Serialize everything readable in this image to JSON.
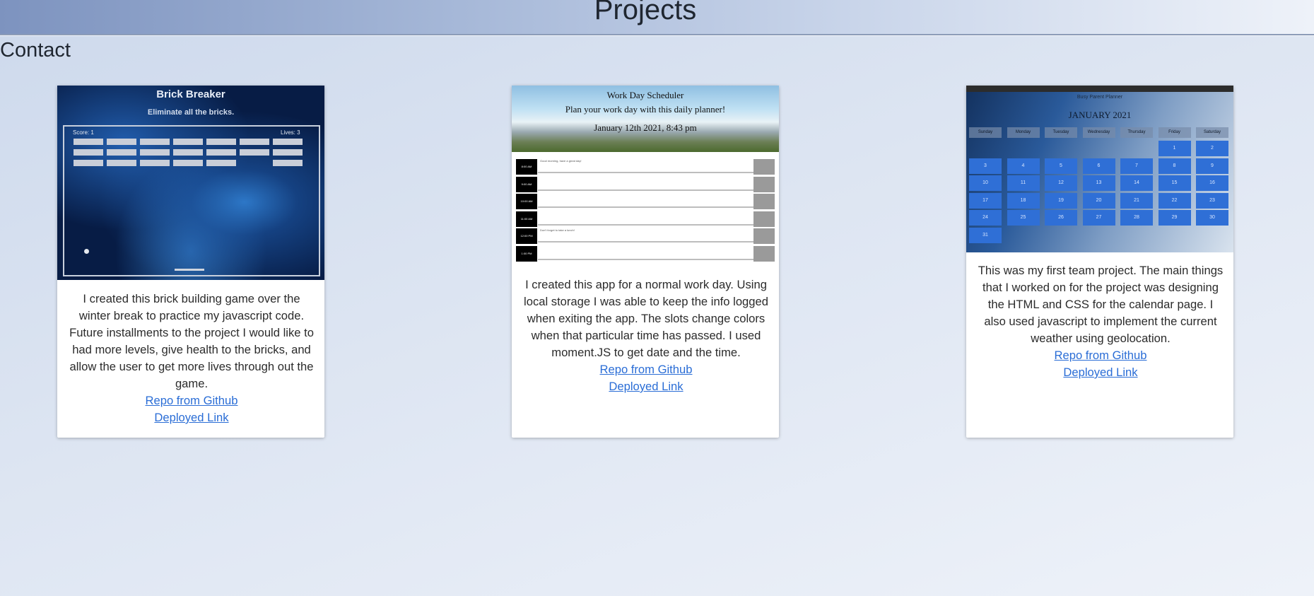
{
  "header": {
    "title": "Projects"
  },
  "nav": {
    "contact": "Contact"
  },
  "cards": [
    {
      "image": {
        "title": "Brick Breaker",
        "subtitle": "Eliminate all the bricks.",
        "score_label": "Score: 1",
        "lives_label": "Lives: 3"
      },
      "description": "I created this brick building game over the winter break to practice my javascript code. Future installments to the project I would like to had more levels, give health to the bricks, and allow the user to get more lives through out the game.",
      "repo_link": "Repo from Github",
      "deployed_link": "Deployed Link"
    },
    {
      "image": {
        "title": "Work Day Scheduler",
        "subtitle": "Plan your work day with this daily planner!",
        "date": "January 12th 2021, 8:43 pm",
        "hours": [
          "8:00 AM",
          "9:00 AM",
          "10:00 AM",
          "11:00 AM",
          "12:00 PM",
          "1:00 PM"
        ],
        "entries": [
          "Good morning, have a great day!",
          "",
          "",
          "",
          "Don't forget to take a lunch!",
          ""
        ]
      },
      "description": "I created this app for a normal work day. Using local storage I was able to keep the info logged when exiting the app. The slots change colors when that particular time has passed. I used moment.JS to get date and the time.",
      "repo_link": "Repo from Github",
      "deployed_link": "Deployed Link"
    },
    {
      "image": {
        "title": "Busy Parent Planner",
        "month": "JANUARY 2021",
        "weekdays": [
          "Sunday",
          "Monday",
          "Tuesday",
          "Wednesday",
          "Thursday",
          "Friday",
          "Saturday"
        ],
        "days": [
          "",
          "",
          "",
          "",
          "",
          "1",
          "2",
          "3",
          "4",
          "5",
          "6",
          "7",
          "8",
          "9",
          "10",
          "11",
          "12",
          "13",
          "14",
          "15",
          "16",
          "17",
          "18",
          "19",
          "20",
          "21",
          "22",
          "23",
          "24",
          "25",
          "26",
          "27",
          "28",
          "29",
          "30",
          "31"
        ]
      },
      "description": "This was my first team project. The main things that I worked on for the project was designing the HTML and CSS for the calendar page. I also used javascript to implement the current weather using geolocation.",
      "repo_link": "Repo from Github",
      "deployed_link": "Deployed Link"
    }
  ]
}
